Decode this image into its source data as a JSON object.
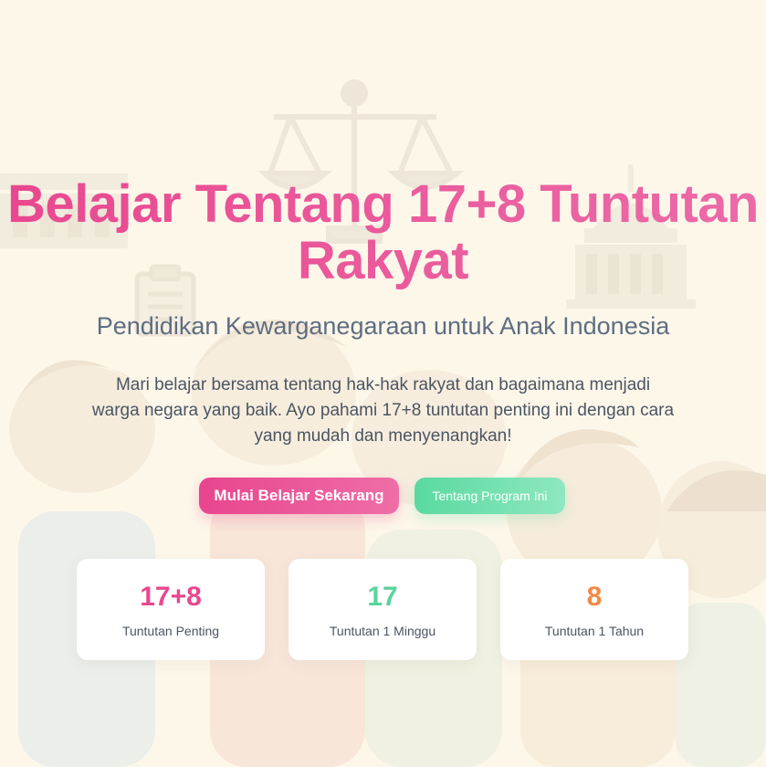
{
  "hero": {
    "title_line1": "Belajar Tentang 17+8 Tuntutan",
    "title_line2": "Rakyat",
    "subtitle": "Pendidikan Kewarganegaraan untuk Anak Indonesia",
    "intro_line1": "Mari belajar bersama tentang hak-hak rakyat dan bagaimana menjadi",
    "intro_line2": "warga negara yang baik. Ayo pahami 17+8 tuntutan penting ini dengan cara",
    "intro_line3": "yang mudah dan menyenangkan!"
  },
  "buttons": {
    "primary_label": "Mulai Belajar Sekarang",
    "secondary_label": "Tentang Program Ini"
  },
  "stats": [
    {
      "value": "17+8",
      "label": "Tuntutan Penting",
      "color": "#e9478f"
    },
    {
      "value": "17",
      "label": "Tuntutan 1 Minggu",
      "color": "#5ad39c"
    },
    {
      "value": "8",
      "label": "Tuntutan 1 Tahun",
      "color": "#f08a45"
    }
  ],
  "colors": {
    "background": "#fdf7ea",
    "title": "#e9478f",
    "subtitle": "#5e6d82",
    "body_text": "#4b5563"
  },
  "icons": [
    "scales-of-justice-icon",
    "building-icon",
    "clipboard-icon",
    "dome-building-icon",
    "children-illustration"
  ]
}
